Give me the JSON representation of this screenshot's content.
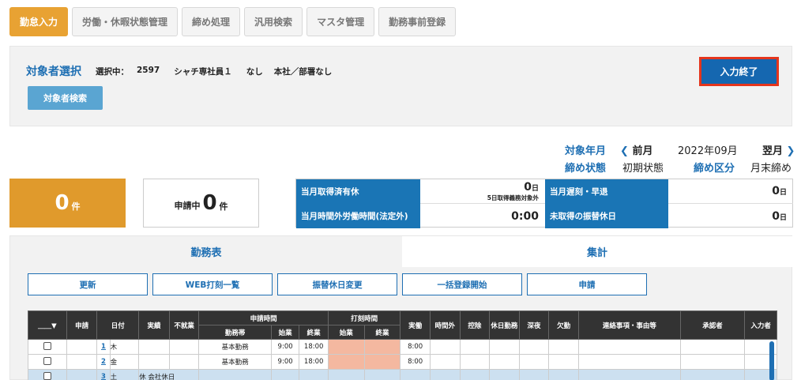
{
  "nav": {
    "tabs": [
      {
        "label": "勤怠入力"
      },
      {
        "label": "労働・休暇状態管理"
      },
      {
        "label": "締め処理"
      },
      {
        "label": "汎用検索"
      },
      {
        "label": "マスタ管理"
      },
      {
        "label": "勤務事前登録"
      }
    ],
    "active_index": 0
  },
  "selector": {
    "title": "対象者選択",
    "selecting_label": "選択中：",
    "employee_id": "2597",
    "employee_name": "シャチ専社員１",
    "status": "なし",
    "department": "本社／部署なし",
    "search_button": "対象者検索",
    "finish_button": "入力終了"
  },
  "period": {
    "target_month_label": "対象年月",
    "prev_label": "前月",
    "current_month": "2022年09月",
    "next_label": "翌月",
    "closing_state_label": "締め状態",
    "closing_state": "初期状態",
    "closing_type_label": "締め区分",
    "closing_type": "月末締め"
  },
  "counts": {
    "main_count": "0",
    "main_unit": "件",
    "applying_label": "申請中",
    "applying_count": "0",
    "applying_unit": "件"
  },
  "stats": {
    "paid_leave_label": "当月取得済有休",
    "paid_leave_value": "0",
    "paid_leave_unit": "日",
    "paid_leave_note": "5日取得義務対象外",
    "late_label": "当月遅刻・早退",
    "late_value": "0",
    "late_unit": "日",
    "overtime_label": "当月時間外労働時間(法定外)",
    "overtime_value": "0:00",
    "substitute_label": "未取得の振替休日",
    "substitute_value": "0",
    "substitute_unit": "日"
  },
  "view_tabs": {
    "schedule": "勤務表",
    "summary": "集計"
  },
  "actions": {
    "refresh": "更新",
    "web_stamp": "WEB打刻一覧",
    "substitute_change": "振替休日変更",
    "bulk_register": "一括登録開始",
    "apply": "申請"
  },
  "table": {
    "select_header": "＿＿▼",
    "headers": {
      "apply": "申請",
      "date": "日付",
      "actual": "実績",
      "no_work": "不就業",
      "requested_time": "申請時間",
      "stamp_time": "打刻時間",
      "work": "実働",
      "overtime": "時間外",
      "deduction": "控除",
      "holiday_work": "休日勤務",
      "late_night": "深夜",
      "absence": "欠勤",
      "notes": "連絡事項・事由等",
      "approver": "承認者",
      "entered_by": "入力者",
      "shift": "勤務帯",
      "start": "始業",
      "end": "終業",
      "stamp_start": "始業",
      "stamp_end": "終業"
    },
    "rows": [
      {
        "day": "1",
        "weekday": "木",
        "shift": "基本勤務",
        "start": "9:00",
        "end": "18:00",
        "work": "8:00",
        "extra": ""
      },
      {
        "day": "2",
        "weekday": "金",
        "shift": "基本勤務",
        "start": "9:00",
        "end": "18:00",
        "work": "8:00",
        "extra": ""
      },
      {
        "day": "3",
        "weekday": "土",
        "shift": "",
        "start": "",
        "end": "",
        "work": "",
        "extra": "休 会社休日"
      }
    ]
  }
}
